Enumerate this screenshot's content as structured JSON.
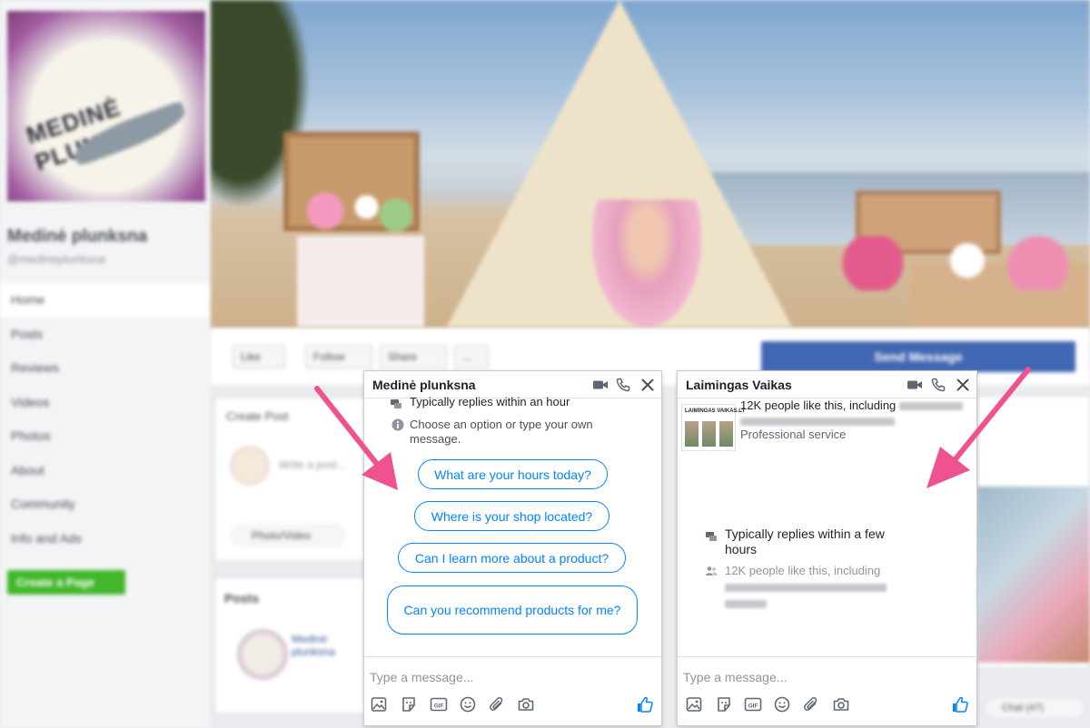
{
  "background_page": {
    "page_name": "Medinė plunksna",
    "page_handle": "@medineplunksna",
    "logo_text": "MEDINĖ PLUNKSNA",
    "nav_items": [
      "Home",
      "Posts",
      "Reviews",
      "Videos",
      "Photos",
      "About",
      "Community",
      "Info and Ads"
    ],
    "create_page_label": "Create a Page",
    "action_buttons": [
      "Like",
      "Follow",
      "Share",
      "..."
    ],
    "send_message_label": "Send Message",
    "create_post_label": "Create Post",
    "write_post_placeholder": "Write a post...",
    "photo_video_label": "Photo/Video",
    "posts_heading": "Posts",
    "post_author": "Medinė plunksna",
    "bottom_chip_label": "Chat (47)"
  },
  "chat1": {
    "title": "Medinė plunksna",
    "response_time": "Typically replies within an hour",
    "instruction": "Choose an option or type your own message.",
    "quick_replies": [
      "What are your hours today?",
      "Where is your shop located?",
      "Can I learn more about a product?",
      "Can you recommend products for me?"
    ],
    "input_placeholder": "Type a message..."
  },
  "chat2": {
    "title": "Laimingas Vaikas",
    "thumb_brand": "LAIMINGAS VAIKAS.LT",
    "likes_text": "12K people like this, including",
    "category": "Professional service",
    "response_time": "Typically replies within a few hours",
    "people_text": "12K people like this, including",
    "input_placeholder": "Type a message..."
  },
  "colors": {
    "messenger_blue": "#0084ff",
    "facebook_blue": "#4267b2",
    "arrow_pink": "#f0518f",
    "create_page_green": "#42b72a"
  },
  "icons": {
    "header": [
      "video-camera-icon",
      "phone-icon",
      "close-icon"
    ],
    "composer": [
      "photo-icon",
      "sticker-icon",
      "gif-icon",
      "emoji-icon",
      "attachment-icon",
      "camera-icon",
      "thumbs-up-icon"
    ]
  }
}
